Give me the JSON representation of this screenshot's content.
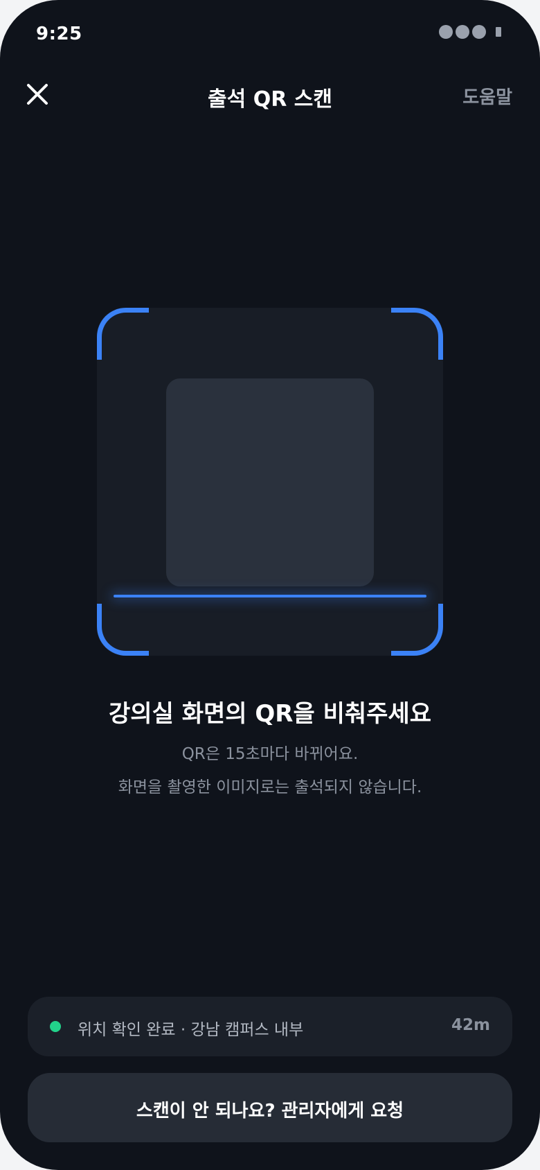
{
  "status_bar": {
    "time": "9:25"
  },
  "header": {
    "close_icon": "close-icon",
    "title": "출석 QR 스캔",
    "help_label": "도움말"
  },
  "scanner": {
    "accent_color": "#3b82f6"
  },
  "instructions": {
    "title": "강의실 화면의 QR을 비춰주세요",
    "line1": "QR은 15초마다 바뀌어요.",
    "line2": "화면을 촬영한 이미지로는 출석되지 않습니다."
  },
  "location": {
    "status_color": "#22d38b",
    "text": "위치 확인 완료 · 강남 캠퍼스 내부",
    "distance": "42m"
  },
  "request_button": {
    "label": "스캔이 안 되나요? 관리자에게 요청"
  }
}
